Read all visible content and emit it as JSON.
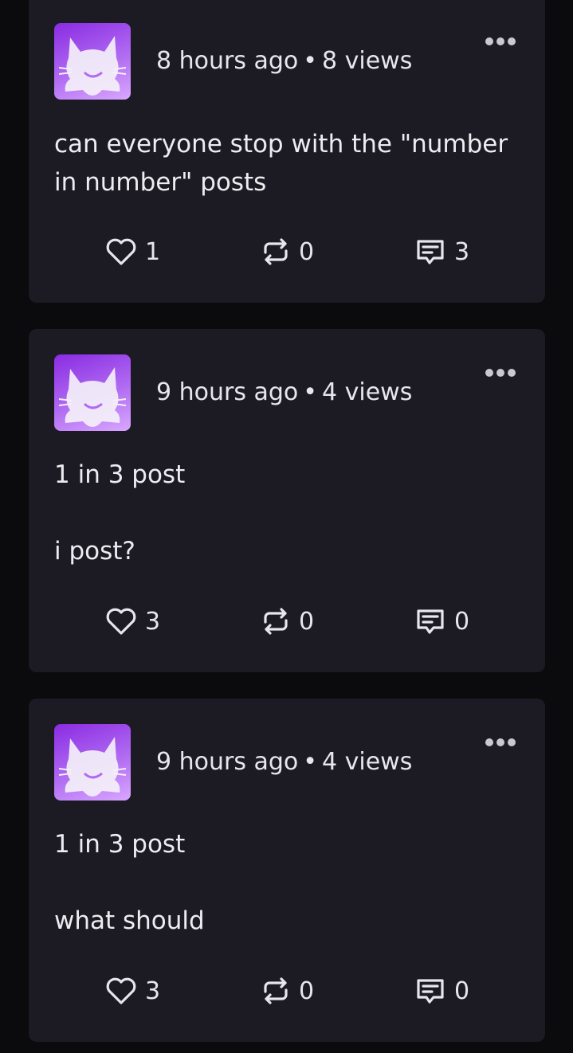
{
  "posts": [
    {
      "time": "8 hours ago",
      "separator": "•",
      "views": "8 views",
      "body": [
        "can everyone stop with the \"number in number\" posts"
      ],
      "likes": "1",
      "reposts": "0",
      "replies": "3"
    },
    {
      "time": "9 hours ago",
      "separator": "•",
      "views": "4 views",
      "body": [
        "1 in 3 post",
        "i post?"
      ],
      "likes": "3",
      "reposts": "0",
      "replies": "0"
    },
    {
      "time": "9 hours ago",
      "separator": "•",
      "views": "4 views",
      "body": [
        "1 in 3 post",
        "what should"
      ],
      "likes": "3",
      "reposts": "0",
      "replies": "0"
    }
  ],
  "icons": {
    "like": "heart-icon",
    "repost": "repost-icon",
    "reply": "comment-icon",
    "more": "more-dots-icon"
  },
  "colors": {
    "background": "#0b0b0e",
    "card": "#1c1b23",
    "text": "#e9e9ee",
    "avatar_accent": "#8a2be2"
  }
}
